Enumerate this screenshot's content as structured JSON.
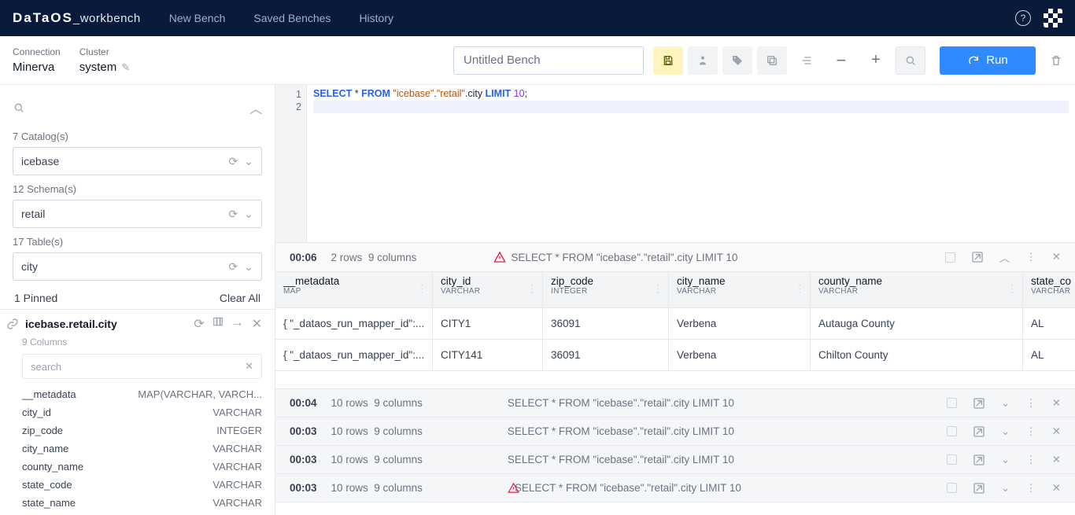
{
  "top": {
    "brand": "DaTaOS",
    "brand_suffix": "_workbench",
    "nav": {
      "new_bench": "New Bench",
      "saved": "Saved Benches",
      "history": "History"
    }
  },
  "sub": {
    "connection_lbl": "Connection",
    "connection_val": "Minerva",
    "cluster_lbl": "Cluster",
    "cluster_val": "system",
    "bench_name": "Untitled Bench",
    "run": "Run"
  },
  "side": {
    "catalog_lbl": "7 Catalog(s)",
    "catalog_val": "icebase",
    "schema_lbl": "12 Schema(s)",
    "schema_val": "retail",
    "table_lbl": "17 Table(s)",
    "table_val": "city",
    "pinned_lbl": "1 Pinned",
    "clear_all": "Clear All",
    "pinned_name": "icebase.retail.city",
    "pinned_colcount": "9 Columns",
    "search_placeholder": "search",
    "cols": [
      {
        "n": "__metadata",
        "t": "MAP(VARCHAR, VARCH..."
      },
      {
        "n": "city_id",
        "t": "VARCHAR"
      },
      {
        "n": "zip_code",
        "t": "INTEGER"
      },
      {
        "n": "city_name",
        "t": "VARCHAR"
      },
      {
        "n": "county_name",
        "t": "VARCHAR"
      },
      {
        "n": "state_code",
        "t": "VARCHAR"
      },
      {
        "n": "state_name",
        "t": "VARCHAR"
      }
    ]
  },
  "editor": {
    "line1_kw1": "SELECT",
    "line1_mid": " * ",
    "line1_kw2": "FROM",
    "line1_s1": "\"icebase\"",
    "line1_dot1": ".",
    "line1_s2": "\"retail\"",
    "line1_tail": ".city ",
    "line1_kw3": "LIMIT",
    "line1_sp": " ",
    "line1_num": "10",
    "line1_sc": ";",
    "g1": "1",
    "g2": "2"
  },
  "result": {
    "time": "00:06",
    "rows": "2 rows",
    "cols": "9 columns",
    "query": "SELECT * FROM \"icebase\".\"retail\".city LIMIT 10",
    "columns": [
      {
        "n": "__metadata",
        "t": "MAP"
      },
      {
        "n": "city_id",
        "t": "VARCHAR"
      },
      {
        "n": "zip_code",
        "t": "INTEGER"
      },
      {
        "n": "city_name",
        "t": "VARCHAR"
      },
      {
        "n": "county_name",
        "t": "VARCHAR"
      },
      {
        "n": "state_co",
        "t": "VARCHAR"
      }
    ],
    "data": [
      [
        "{ \"_dataos_run_mapper_id\":...",
        "CITY1",
        "36091",
        "Verbena",
        "Autauga County",
        "AL"
      ],
      [
        "{ \"_dataos_run_mapper_id\":...",
        "CITY141",
        "36091",
        "Verbena",
        "Chilton County",
        "AL"
      ]
    ]
  },
  "history": [
    {
      "time": "00:04",
      "rows": "10 rows",
      "cols": "9 columns",
      "warn": false,
      "q": "SELECT * FROM \"icebase\".\"retail\".city LIMIT 10"
    },
    {
      "time": "00:03",
      "rows": "10 rows",
      "cols": "9 columns",
      "warn": false,
      "q": "SELECT * FROM \"icebase\".\"retail\".city LIMIT 10"
    },
    {
      "time": "00:03",
      "rows": "10 rows",
      "cols": "9 columns",
      "warn": false,
      "q": "SELECT * FROM \"icebase\".\"retail\".city LIMIT 10"
    },
    {
      "time": "00:03",
      "rows": "10 rows",
      "cols": "9 columns",
      "warn": true,
      "q": "SELECT * FROM \"icebase\".\"retail\".city LIMIT 10"
    }
  ]
}
